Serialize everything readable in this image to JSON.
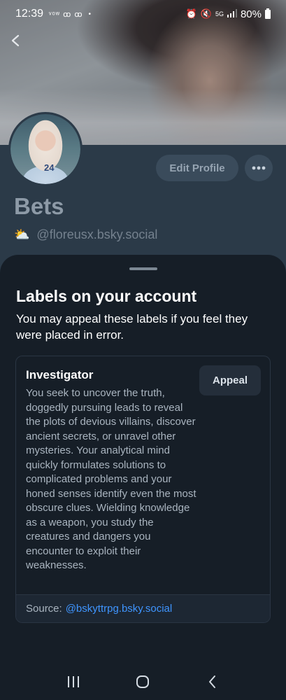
{
  "status_bar": {
    "time": "12:39",
    "notification_icons": "ᵛᵒʷ ꝏ ꝏ",
    "dot": "•",
    "network": "5G",
    "battery": "80%"
  },
  "profile": {
    "display_name": "Bets",
    "handle": "@floreusx.bsky.social",
    "handle_emoji": "⛅",
    "edit_profile_label": "Edit Profile",
    "avatar_shirt_text": "24"
  },
  "sheet": {
    "title": "Labels on your account",
    "subtitle": "You may appeal these labels if you feel they were placed in error.",
    "labels": [
      {
        "name": "Investigator",
        "description": "You seek to uncover the truth, doggedly pursuing leads to reveal the plots of devious villains, discover ancient secrets, or unravel other mysteries. Your analytical mind quickly formulates solutions to complicated problems and your honed senses identify even the most obscure clues. Wielding knowledge as a weapon, you study the creatures and dangers you encounter to exploit their weaknesses.",
        "appeal_label": "Appeal",
        "source_label": "Source:",
        "source_handle": "@bskyttrpg.bsky.social"
      }
    ]
  },
  "colors": {
    "accent_link": "#3f95ff",
    "sheet_bg": "#161e27",
    "profile_bg": "#2b3a48"
  }
}
